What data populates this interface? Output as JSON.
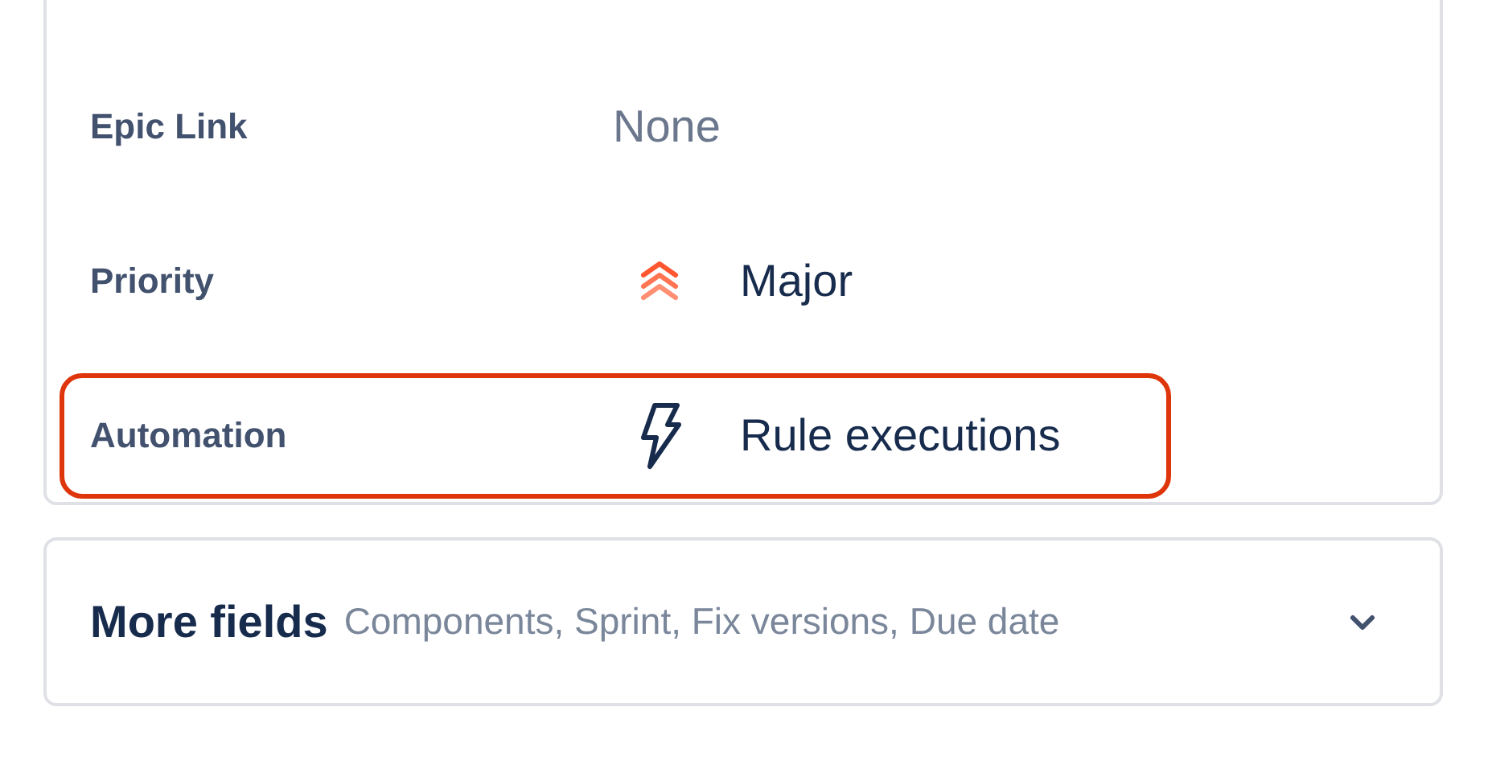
{
  "fields": [
    {
      "label": "Epic Link",
      "value": "None",
      "kind": "plain",
      "empty": true,
      "highlighted": false
    },
    {
      "label": "Priority",
      "value": "Major",
      "kind": "priority",
      "empty": false,
      "highlighted": false
    },
    {
      "label": "Automation",
      "value": "Rule executions",
      "kind": "automation",
      "empty": false,
      "highlighted": true
    }
  ],
  "more_fields": {
    "title": "More fields",
    "summary": "Components, Sprint, Fix versions, Due date",
    "expanded": false
  }
}
